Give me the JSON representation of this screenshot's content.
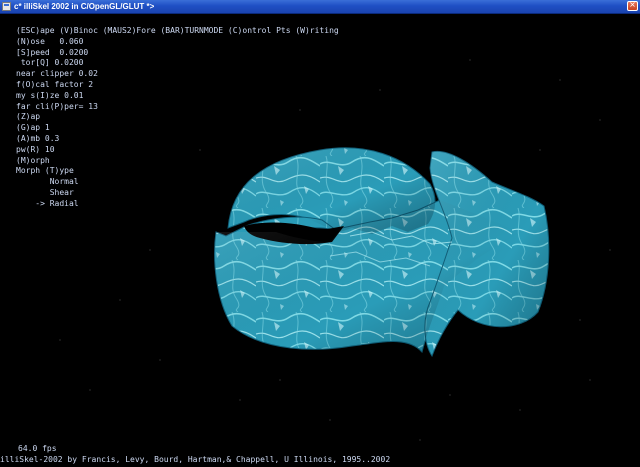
{
  "window": {
    "title": "c* illiSkel 2002 in C/OpenGL/GLUT *>",
    "close_glyph": "×"
  },
  "menu": {
    "items": [
      "(ESC)ape (V)Binoc (MAUS2)Fore (BAR)TURNMODE (C)ontrol Pts (W)riting",
      "(N)ose   0.060",
      "[S]peed  0.0200",
      " tor[Q] 0.0200",
      "near clipper 0.02",
      "f(O)cal factor 2",
      "my s(I)ze 0.01",
      "far cli(P)per= 13",
      "(Z)ap",
      "(G)ap 1",
      "(A)mb 0.3",
      "pw(R) 10",
      "(M)orph",
      "Morph (T)ype",
      "       Normal",
      "       Shear",
      "    -> Radial"
    ]
  },
  "status": {
    "fps": "64.0 fps",
    "credits": "illiSkel-2002 by Francis, Levy, Bourd, Hartman,& Chappell, U Illinois, 1995..2002"
  },
  "scene": {
    "object": "water-textured-fish-surface",
    "colors": {
      "base": "#2a9cb8",
      "light": "#8fe6f0",
      "dark": "#0f5e78",
      "stars": "#4a4a4a"
    }
  }
}
